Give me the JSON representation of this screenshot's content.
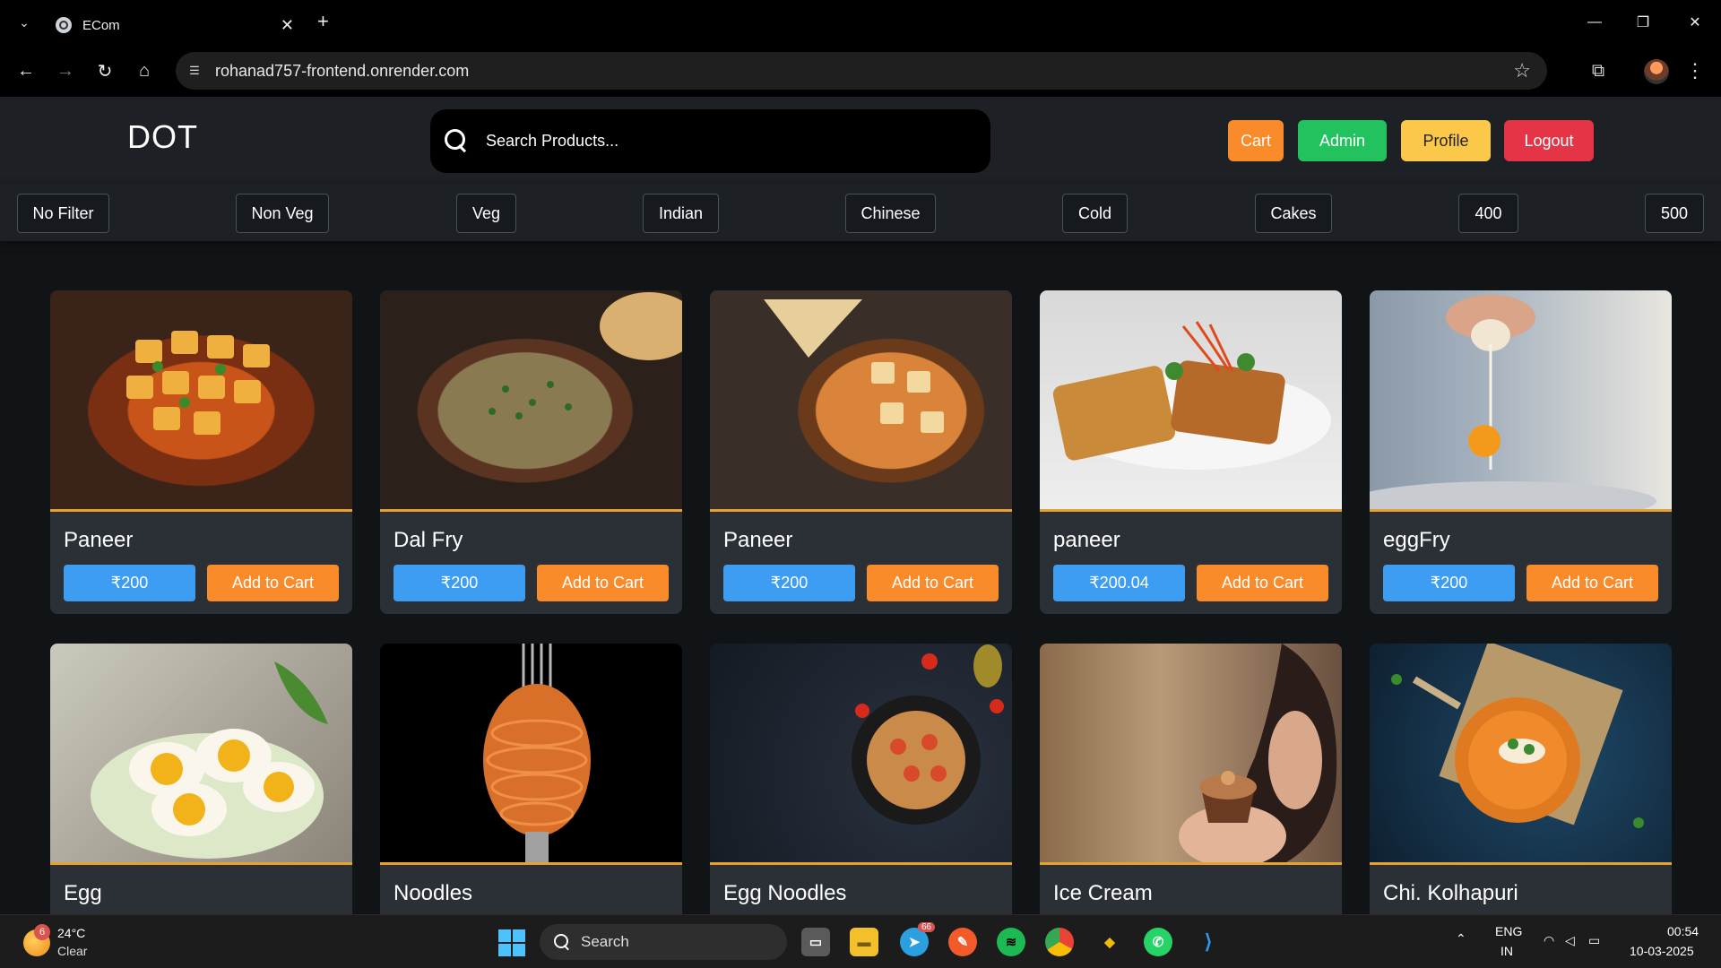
{
  "browser": {
    "tab_title": "ECom",
    "url": "rohanad757-frontend.onrender.com"
  },
  "header": {
    "logo": "DOT",
    "search_placeholder": "Search Products...",
    "cart_label": "Cart",
    "admin_label": "Admin",
    "profile_label": "Profile",
    "logout_label": "Logout",
    "colors": {
      "cart": "#f98b2a",
      "admin": "#22c35e",
      "profile": "#fbc84a",
      "logout": "#e53445"
    }
  },
  "filters": [
    "No Filter",
    "Non Veg",
    "Veg",
    "Indian",
    "Chinese",
    "Cold",
    "Cakes",
    "400",
    "500"
  ],
  "products": [
    {
      "name": "Paneer",
      "price": "₹200",
      "cart_label": "Add to Cart",
      "image": "paneer-curry-bowl"
    },
    {
      "name": "Dal Fry",
      "price": "₹200",
      "cart_label": "Add to Cart",
      "image": "dal-fry-bowl"
    },
    {
      "name": "Paneer",
      "price": "₹200",
      "cart_label": "Add to Cart",
      "image": "paneer-gravy-plate"
    },
    {
      "name": "paneer",
      "price": "₹200.04",
      "cart_label": "Add to Cart",
      "image": "grilled-paneer-plate"
    },
    {
      "name": "eggFry",
      "price": "₹200",
      "cart_label": "Add to Cart",
      "image": "egg-cracking"
    },
    {
      "name": "Egg",
      "image": "boiled-eggs-bowl"
    },
    {
      "name": "Noodles",
      "image": "noodles-on-fork"
    },
    {
      "name": "Egg Noodles",
      "image": "noodles-pan"
    },
    {
      "name": "Ice Cream",
      "image": "woman-with-cupcake"
    },
    {
      "name": "Chi. Kolhapuri",
      "image": "kolhapuri-soup-bowl"
    }
  ],
  "taskbar": {
    "weather_badge": "6",
    "temperature": "24°C",
    "condition": "Clear",
    "search_label": "Search",
    "telegram_badge": "66",
    "lang_top": "ENG",
    "lang_bottom": "IN",
    "time": "00:54",
    "date": "10-03-2025"
  }
}
